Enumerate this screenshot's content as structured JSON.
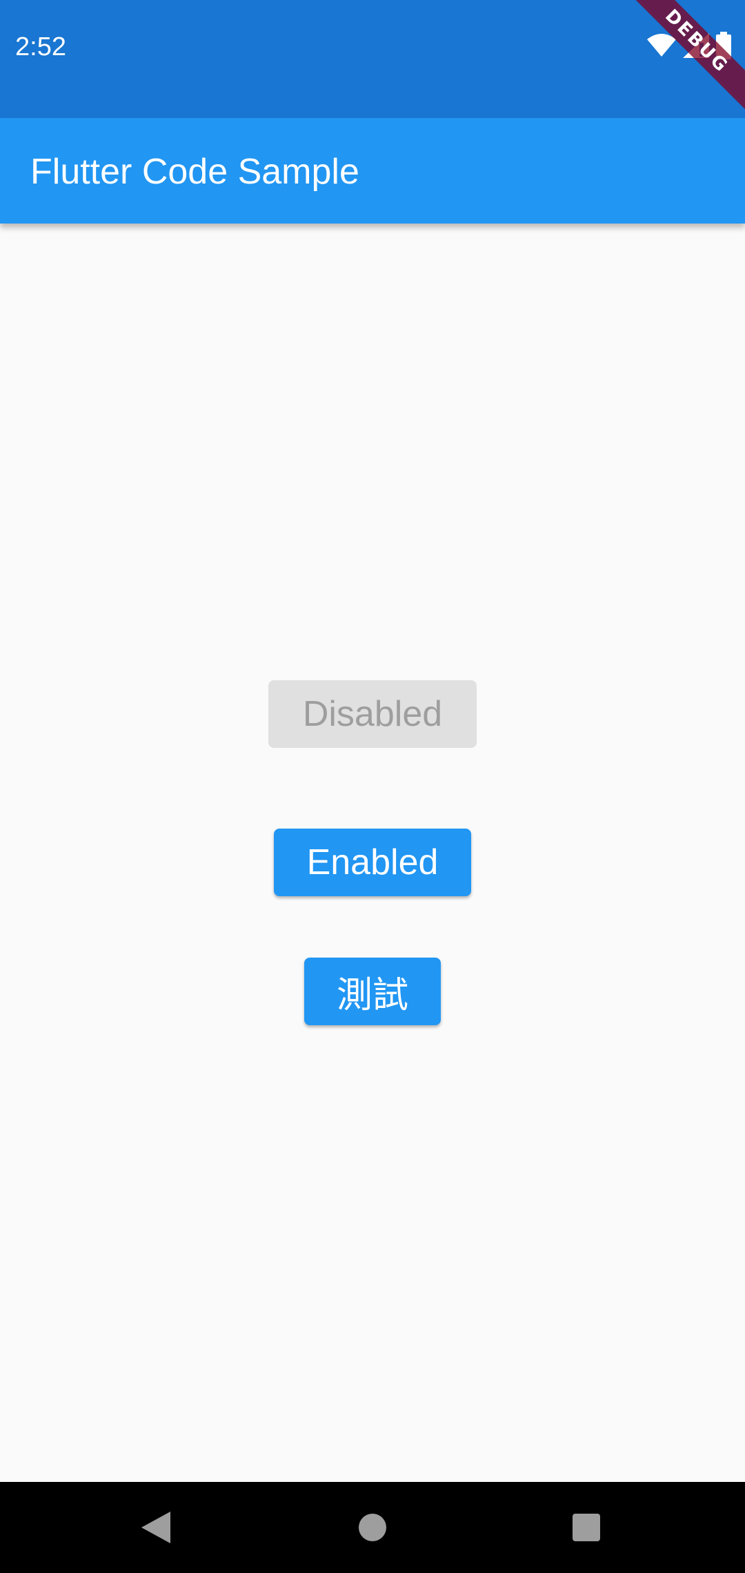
{
  "status_bar": {
    "time": "2:52",
    "icons": [
      "wifi-icon",
      "cell-signal-icon",
      "battery-icon"
    ],
    "color": "#1976d2"
  },
  "debug_banner": {
    "label": "DEBUG",
    "color": "#800020"
  },
  "app_bar": {
    "title": "Flutter Code Sample",
    "color": "#2196f3"
  },
  "buttons": {
    "disabled_label": "Disabled",
    "enabled_label": "Enabled",
    "test_label": "測試"
  },
  "nav_bar": {
    "icons": [
      "back-icon",
      "home-icon",
      "recents-icon"
    ]
  }
}
